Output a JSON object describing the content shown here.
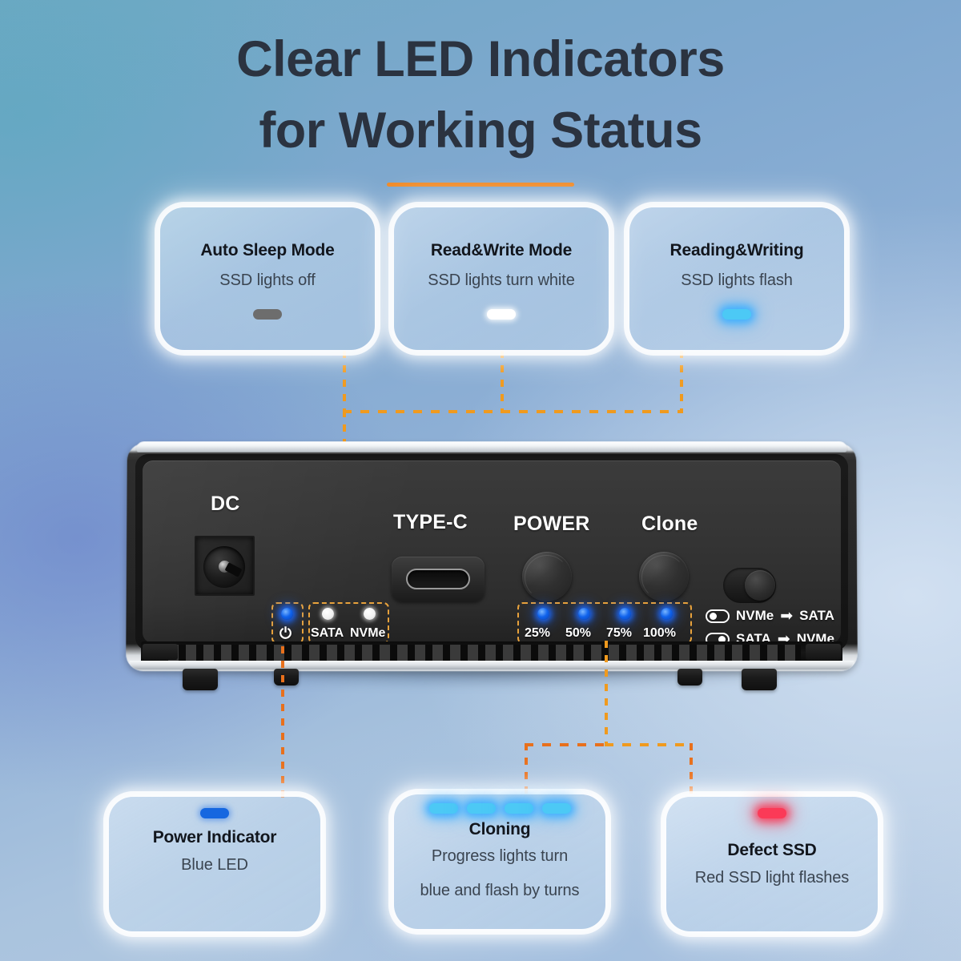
{
  "title": {
    "line1": "Clear LED Indicators",
    "line2": "for Working Status",
    "accent_color": "#f08a26"
  },
  "cards_top": [
    {
      "title": "Auto Sleep Mode",
      "subtitle": "SSD lights off",
      "led": "grey",
      "led_count": 1
    },
    {
      "title": "Read&Write Mode",
      "subtitle": "SSD lights turn white",
      "led": "white",
      "led_count": 1
    },
    {
      "title": "Reading&Writing",
      "subtitle": "SSD lights flash",
      "led": "cyan",
      "led_count": 1
    }
  ],
  "cards_bottom": [
    {
      "title": "Power Indicator",
      "subtitle": "Blue LED",
      "led": "blue",
      "led_count": 1
    },
    {
      "title": "Cloning",
      "subtitle_line1": "Progress lights turn",
      "subtitle_line2": "blue and flash by turns",
      "led": "cyan",
      "led_count": 4
    },
    {
      "title": "Defect SSD",
      "subtitle": "Red SSD light flashes",
      "led": "red",
      "led_count": 1
    }
  ],
  "device": {
    "labels": {
      "dc": "DC",
      "typec": "TYPE-C",
      "power": "POWER",
      "clone": "Clone"
    },
    "status_leds": {
      "power_symbol": "⏻",
      "sata": "SATA",
      "nvme": "NVMe"
    },
    "progress_leds": [
      "25%",
      "50%",
      "75%",
      "100%"
    ],
    "toggle_modes": [
      {
        "knob": "left",
        "from": "NVMe",
        "arrow": "➡",
        "to": "SATA"
      },
      {
        "knob": "right",
        "from": "SATA",
        "arrow": "➡",
        "to": "NVMe"
      }
    ]
  },
  "colors": {
    "led_blue": "#1063ec",
    "led_cyan": "#4cc9f5",
    "led_red": "#fb3a57",
    "led_white": "#ffffff",
    "led_grey": "#6d6d6d",
    "connector_orange": "#f09a1e"
  }
}
